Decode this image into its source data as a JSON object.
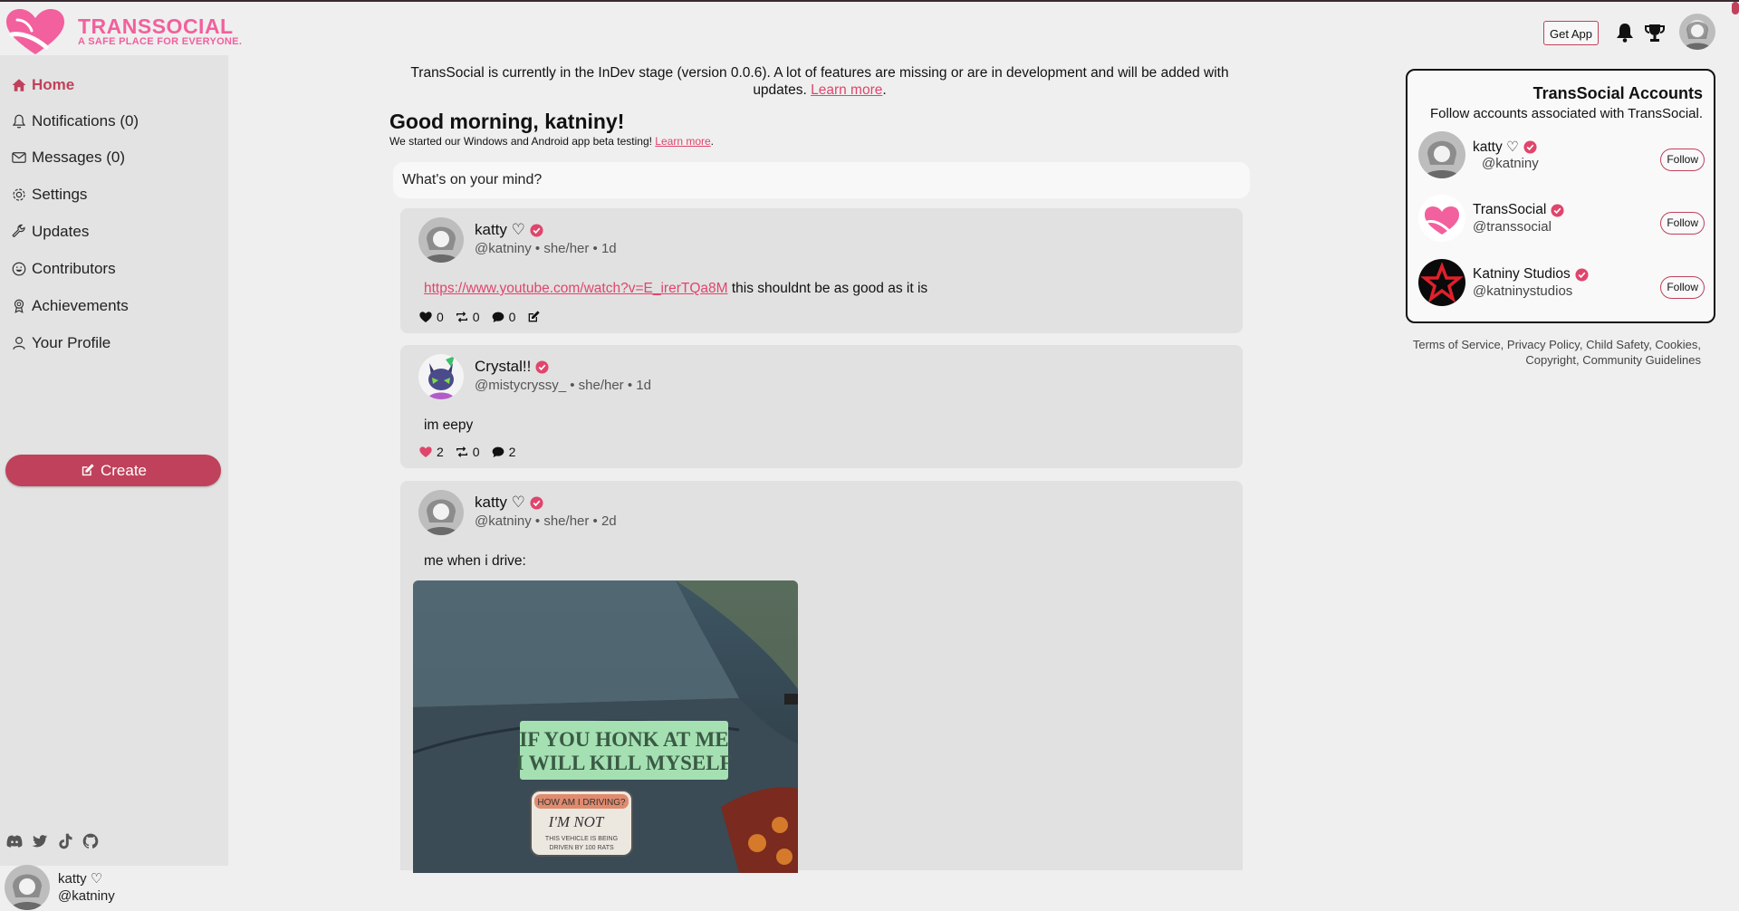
{
  "header": {
    "brand": "TRANSSOCIAL",
    "tagline": "A SAFE PLACE FOR EVERYONE.",
    "get_app": "Get App",
    "accent": "#c0415b",
    "brand_color": "#f2609d"
  },
  "sidebar": {
    "items": [
      {
        "label": "Home",
        "icon": "home-icon"
      },
      {
        "label": "Notifications (0)",
        "icon": "bell-icon"
      },
      {
        "label": "Messages (0)",
        "icon": "envelope-icon"
      },
      {
        "label": "Settings",
        "icon": "gear-icon"
      },
      {
        "label": "Updates",
        "icon": "wrench-icon"
      },
      {
        "label": "Contributors",
        "icon": "smile-icon"
      },
      {
        "label": "Achievements",
        "icon": "award-icon"
      },
      {
        "label": "Your Profile",
        "icon": "user-icon"
      }
    ],
    "create": "Create",
    "social_icons": [
      "discord-icon",
      "twitter-icon",
      "tiktok-icon",
      "github-icon"
    ],
    "me": {
      "name": "katty ♡",
      "handle": "@katniny"
    }
  },
  "main": {
    "banner_text": "TransSocial is currently in the InDev stage (version 0.0.6). A lot of features are missing or are in development and will be added with updates.",
    "banner_link": "Learn more",
    "greeting": "Good morning, katniny!",
    "beta_text": "We started our Windows and Android app beta testing!",
    "beta_link": "Learn more",
    "composer_placeholder": "What's on your mind?"
  },
  "posts": [
    {
      "name": "katty ♡",
      "meta": "@katniny • she/her • 1d",
      "link": "https://www.youtube.com/watch?v=E_irerTQa8M",
      "text": "this shouldnt be as good as it is",
      "likes": "0",
      "reposts": "0",
      "comments": "0"
    },
    {
      "name": "Crystal!!",
      "meta": "@mistycryssy_ • she/her • 1d",
      "text": "im eepy",
      "likes": "2",
      "reposts": "0",
      "comments": "2"
    },
    {
      "name": "katty ♡",
      "meta": "@katniny • she/her • 2d",
      "text": "me when i drive:",
      "sticker_main": "IF YOU HONK AT ME I WILL KILL MYSELF",
      "sticker_top": "HOW AM I DRIVING?",
      "sticker_big": "I'M NOT",
      "sticker_small": "THIS VEHICLE IS BEING DRIVEN BY 100 RATS"
    }
  ],
  "accounts_panel": {
    "title": "TransSocial Accounts",
    "subtitle": "Follow accounts associated with TransSocial.",
    "accounts": [
      {
        "name": "katty ♡",
        "handle": "@katniny",
        "follow": "Follow"
      },
      {
        "name": "TransSocial",
        "handle": "@transsocial",
        "follow": "Follow"
      },
      {
        "name": "Katniny Studios",
        "handle": "@katninystudios",
        "follow": "Follow"
      }
    ]
  },
  "footer": {
    "line1": "Terms of Service, Privacy Policy, Child Safety, Cookies,",
    "line2": "Copyright, Community Guidelines"
  }
}
